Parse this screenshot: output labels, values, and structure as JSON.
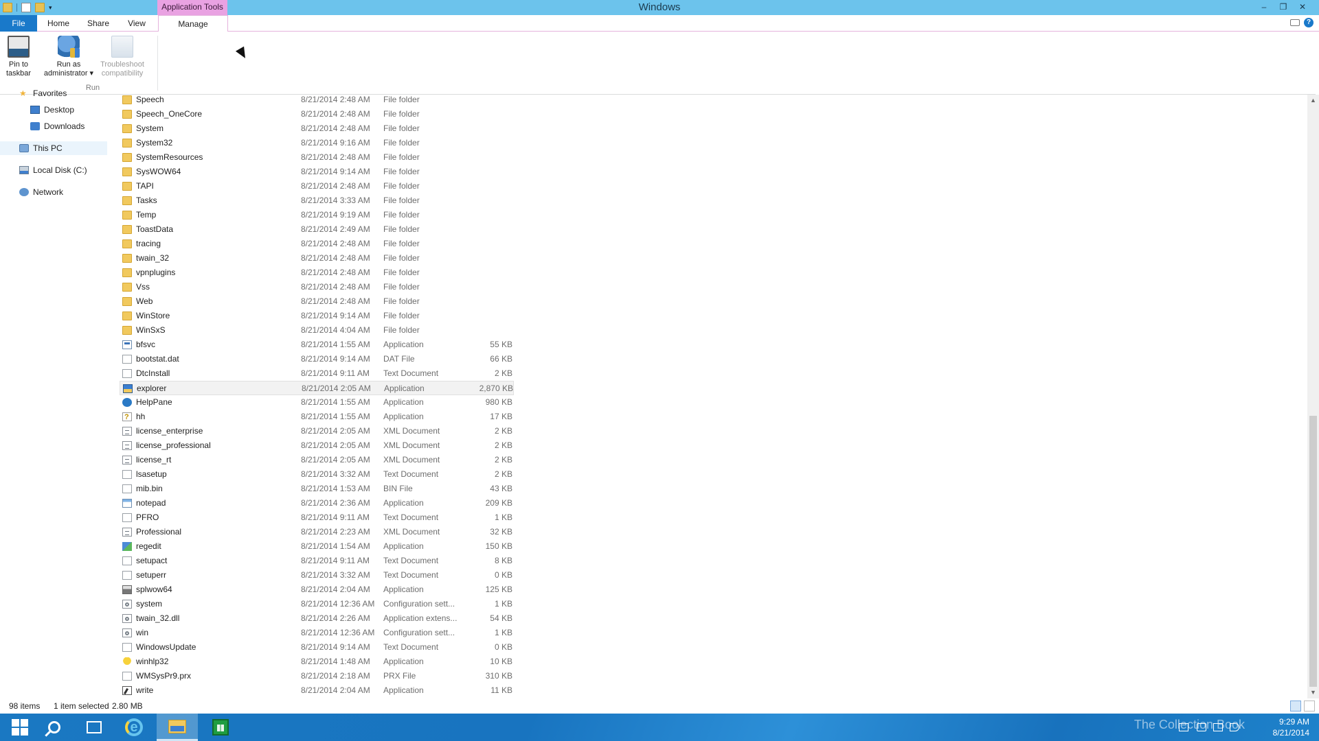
{
  "window": {
    "title": "Windows",
    "context_tab_group": "Application Tools",
    "controls": {
      "minimize": "–",
      "restore": "❐",
      "close": "✕"
    }
  },
  "ribbon": {
    "tabs": {
      "file": "File",
      "home": "Home",
      "share": "Share",
      "view": "View",
      "manage": "Manage"
    },
    "buttons": {
      "pin_line1": "Pin to",
      "pin_line2": "taskbar",
      "runas_line1": "Run as",
      "runas_line2": "administrator ▾",
      "trouble_line1": "Troubleshoot",
      "trouble_line2": "compatibility"
    },
    "group_run": "Run",
    "help": "?"
  },
  "nav": {
    "favorites": "Favorites",
    "desktop": "Desktop",
    "downloads": "Downloads",
    "this_pc": "This PC",
    "local_disk": "Local Disk (C:)",
    "network": "Network"
  },
  "files": [
    {
      "name": "Speech",
      "date": "8/21/2014 2:48 AM",
      "type": "File folder",
      "size": "",
      "icon": "folder"
    },
    {
      "name": "Speech_OneCore",
      "date": "8/21/2014 2:48 AM",
      "type": "File folder",
      "size": "",
      "icon": "folder"
    },
    {
      "name": "System",
      "date": "8/21/2014 2:48 AM",
      "type": "File folder",
      "size": "",
      "icon": "folder"
    },
    {
      "name": "System32",
      "date": "8/21/2014 9:16 AM",
      "type": "File folder",
      "size": "",
      "icon": "folder"
    },
    {
      "name": "SystemResources",
      "date": "8/21/2014 2:48 AM",
      "type": "File folder",
      "size": "",
      "icon": "folder"
    },
    {
      "name": "SysWOW64",
      "date": "8/21/2014 9:14 AM",
      "type": "File folder",
      "size": "",
      "icon": "folder"
    },
    {
      "name": "TAPI",
      "date": "8/21/2014 2:48 AM",
      "type": "File folder",
      "size": "",
      "icon": "folder"
    },
    {
      "name": "Tasks",
      "date": "8/21/2014 3:33 AM",
      "type": "File folder",
      "size": "",
      "icon": "folder"
    },
    {
      "name": "Temp",
      "date": "8/21/2014 9:19 AM",
      "type": "File folder",
      "size": "",
      "icon": "folder"
    },
    {
      "name": "ToastData",
      "date": "8/21/2014 2:49 AM",
      "type": "File folder",
      "size": "",
      "icon": "folder"
    },
    {
      "name": "tracing",
      "date": "8/21/2014 2:48 AM",
      "type": "File folder",
      "size": "",
      "icon": "folder"
    },
    {
      "name": "twain_32",
      "date": "8/21/2014 2:48 AM",
      "type": "File folder",
      "size": "",
      "icon": "folder"
    },
    {
      "name": "vpnplugins",
      "date": "8/21/2014 2:48 AM",
      "type": "File folder",
      "size": "",
      "icon": "folder"
    },
    {
      "name": "Vss",
      "date": "8/21/2014 2:48 AM",
      "type": "File folder",
      "size": "",
      "icon": "folder"
    },
    {
      "name": "Web",
      "date": "8/21/2014 2:48 AM",
      "type": "File folder",
      "size": "",
      "icon": "folder"
    },
    {
      "name": "WinStore",
      "date": "8/21/2014 9:14 AM",
      "type": "File folder",
      "size": "",
      "icon": "folder"
    },
    {
      "name": "WinSxS",
      "date": "8/21/2014 4:04 AM",
      "type": "File folder",
      "size": "",
      "icon": "folder"
    },
    {
      "name": "bfsvc",
      "date": "8/21/2014 1:55 AM",
      "type": "Application",
      "size": "55 KB",
      "icon": "app"
    },
    {
      "name": "bootstat.dat",
      "date": "8/21/2014 9:14 AM",
      "type": "DAT File",
      "size": "66 KB",
      "icon": "doc"
    },
    {
      "name": "DtcInstall",
      "date": "8/21/2014 9:11 AM",
      "type": "Text Document",
      "size": "2 KB",
      "icon": "doc"
    },
    {
      "name": "explorer",
      "date": "8/21/2014 2:05 AM",
      "type": "Application",
      "size": "2,870 KB",
      "icon": "explorer",
      "selected": true
    },
    {
      "name": "HelpPane",
      "date": "8/21/2014 1:55 AM",
      "type": "Application",
      "size": "980 KB",
      "icon": "help"
    },
    {
      "name": "hh",
      "date": "8/21/2014 1:55 AM",
      "type": "Application",
      "size": "17 KB",
      "icon": "hh"
    },
    {
      "name": "license_enterprise",
      "date": "8/21/2014 2:05 AM",
      "type": "XML Document",
      "size": "2 KB",
      "icon": "xml"
    },
    {
      "name": "license_professional",
      "date": "8/21/2014 2:05 AM",
      "type": "XML Document",
      "size": "2 KB",
      "icon": "xml"
    },
    {
      "name": "license_rt",
      "date": "8/21/2014 2:05 AM",
      "type": "XML Document",
      "size": "2 KB",
      "icon": "xml"
    },
    {
      "name": "lsasetup",
      "date": "8/21/2014 3:32 AM",
      "type": "Text Document",
      "size": "2 KB",
      "icon": "doc"
    },
    {
      "name": "mib.bin",
      "date": "8/21/2014 1:53 AM",
      "type": "BIN File",
      "size": "43 KB",
      "icon": "doc"
    },
    {
      "name": "notepad",
      "date": "8/21/2014 2:36 AM",
      "type": "Application",
      "size": "209 KB",
      "icon": "notepad"
    },
    {
      "name": "PFRO",
      "date": "8/21/2014 9:11 AM",
      "type": "Text Document",
      "size": "1 KB",
      "icon": "doc"
    },
    {
      "name": "Professional",
      "date": "8/21/2014 2:23 AM",
      "type": "XML Document",
      "size": "32 KB",
      "icon": "xml"
    },
    {
      "name": "regedit",
      "date": "8/21/2014 1:54 AM",
      "type": "Application",
      "size": "150 KB",
      "icon": "regedit"
    },
    {
      "name": "setupact",
      "date": "8/21/2014 9:11 AM",
      "type": "Text Document",
      "size": "8 KB",
      "icon": "doc"
    },
    {
      "name": "setuperr",
      "date": "8/21/2014 3:32 AM",
      "type": "Text Document",
      "size": "0 KB",
      "icon": "doc"
    },
    {
      "name": "splwow64",
      "date": "8/21/2014 2:04 AM",
      "type": "Application",
      "size": "125 KB",
      "icon": "printer"
    },
    {
      "name": "system",
      "date": "8/21/2014 12:36 AM",
      "type": "Configuration sett...",
      "size": "1 KB",
      "icon": "gear"
    },
    {
      "name": "twain_32.dll",
      "date": "8/21/2014 2:26 AM",
      "type": "Application extens...",
      "size": "54 KB",
      "icon": "gear"
    },
    {
      "name": "win",
      "date": "8/21/2014 12:36 AM",
      "type": "Configuration sett...",
      "size": "1 KB",
      "icon": "gear"
    },
    {
      "name": "WindowsUpdate",
      "date": "8/21/2014 9:14 AM",
      "type": "Text Document",
      "size": "0 KB",
      "icon": "doc"
    },
    {
      "name": "winhlp32",
      "date": "8/21/2014 1:48 AM",
      "type": "Application",
      "size": "10 KB",
      "icon": "bulb"
    },
    {
      "name": "WMSysPr9.prx",
      "date": "8/21/2014 2:18 AM",
      "type": "PRX File",
      "size": "310 KB",
      "icon": "doc"
    },
    {
      "name": "write",
      "date": "8/21/2014 2:04 AM",
      "type": "Application",
      "size": "11 KB",
      "icon": "write"
    }
  ],
  "status": {
    "item_count": "98 items",
    "selected": "1 item selected",
    "selected_size": "2.80 MB"
  },
  "taskbar": {
    "clock_time": "9:29 AM",
    "clock_date": "8/21/2014",
    "watermark": "The Collection Book"
  },
  "colors": {
    "titlebar": "#6cc3ec",
    "context_tab": "#e9a2e2",
    "file_tab": "#1979ca",
    "taskbar": "#1874c0"
  }
}
